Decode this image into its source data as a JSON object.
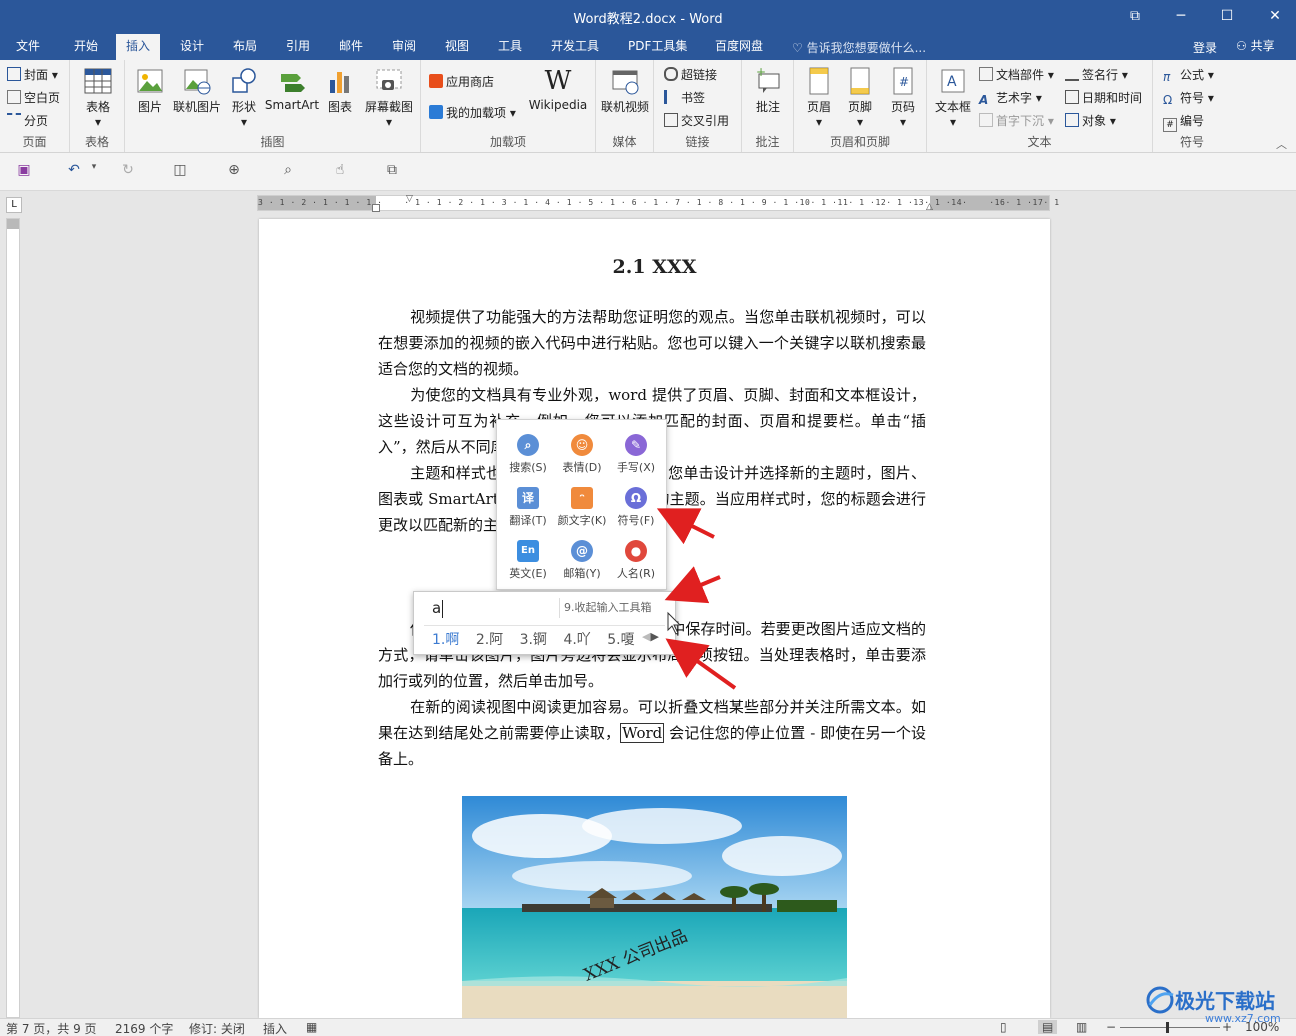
{
  "window": {
    "title": "Word教程2.docx - Word",
    "controls": [
      "⧉",
      "─",
      "☐",
      "✕"
    ]
  },
  "tabs": [
    "文件",
    "开始",
    "插入",
    "设计",
    "布局",
    "引用",
    "邮件",
    "审阅",
    "视图",
    "工具",
    "开发工具",
    "PDF工具集",
    "百度网盘"
  ],
  "active_tab": "插入",
  "tell_me": "告诉我您想要做什么...",
  "login": "登录",
  "share": "共享",
  "ribbon": {
    "pages": {
      "label": "页面",
      "items": [
        "封面",
        "空白页",
        "分页"
      ]
    },
    "tables": {
      "label": "表格",
      "items": [
        "表格"
      ]
    },
    "illustrations": {
      "label": "插图",
      "items": [
        "图片",
        "联机图片",
        "形状",
        "SmartArt",
        "图表",
        "屏幕截图"
      ]
    },
    "addins": {
      "label": "加载项",
      "items": [
        "应用商店",
        "我的加载项",
        "Wikipedia"
      ]
    },
    "media": {
      "label": "媒体",
      "items": [
        "联机视频"
      ]
    },
    "links": {
      "label": "链接",
      "items": [
        "超链接",
        "书签",
        "交叉引用"
      ]
    },
    "comments": {
      "label": "批注",
      "items": [
        "批注"
      ]
    },
    "header_footer": {
      "label": "页眉和页脚",
      "items": [
        "页眉",
        "页脚",
        "页码"
      ]
    },
    "text": {
      "label": "文本",
      "items": [
        "文本框",
        "文档部件",
        "艺术字",
        "首字下沉",
        "签名行",
        "日期和时间",
        "对象"
      ]
    },
    "symbols": {
      "label": "符号",
      "items": [
        "公式",
        "符号",
        "编号"
      ]
    }
  },
  "ruler_ticks": "3 · 1 · 2 · 1 · 1 · 1 ·    · 1 · 1 · 2 · 1 · 3 · 1 · 4 · 1 · 5 · 1 · 6 · 1 · 7 · 1 · 8 · 1 · 9 · 1 ·10· 1 ·11· 1 ·12· 1 ·13· 1 ·14·    ·16· 1 ·17· 1",
  "document": {
    "heading": "2.1 XXX",
    "p1": "视频提供了功能强大的方法帮助您证明您的观点。当您单击联机视频时，可以在想要添加的视频的嵌入代码中进行粘贴。您也可以键入一个关键字以联机搜索最适合您的文档的视频。",
    "p2": "为使您的文档具有专业外观，word 提供了页眉、页脚、封面和文本框设计，这些设计可互为补充。例如，您可以添加匹配的封面、页眉和提要栏。单击“插入”，然后从不同库中选择所需元素。",
    "p3": "主题和样式也有助于文档保持协调。当您单击设计并选择新的主题时，图片、图表或 SmartArt 图形将会更改以匹配新的主题。当应用样式时，您的标题会进行更改以匹配新的主题。",
    "p4": "使用在需要位置出现的新按钮在 Word 中保存时间。若要更改图片适应文档的方式，请单击该图片，图片旁边将会显示布局选项按钮。当处理表格时，单击要添加行或列的位置，然后单击加号。",
    "p5_a": "在新的阅读视图中阅读更加容易。可以折叠文档某些部分并关注所需文本。如果在达到结尾处之前需要停止读取，",
    "p5_word": "Word",
    "p5_b": " 会记住您的停止位置 - 即使在另一个设备上。",
    "image_caption": "XXX 公司出品"
  },
  "ime_toolbox": {
    "items": [
      {
        "label": "搜索(S)",
        "icon": "search-icon",
        "color": "#5b8fd6"
      },
      {
        "label": "表情(D)",
        "icon": "emoji-icon",
        "color": "#f08a3c"
      },
      {
        "label": "手写(X)",
        "icon": "handwrite-icon",
        "color": "#8a67d6"
      },
      {
        "label": "翻译(T)",
        "icon": "translate-icon",
        "color": "#5b8fd6"
      },
      {
        "label": "颜文字(K)",
        "icon": "kaomoji-icon",
        "color": "#f08a3c"
      },
      {
        "label": "符号(F)",
        "icon": "omega-icon",
        "color": "#6a6fd8"
      },
      {
        "label": "英文(E)",
        "icon": "english-icon",
        "color": "#3c8ee0"
      },
      {
        "label": "邮箱(Y)",
        "icon": "email-icon",
        "color": "#5b8fd6"
      },
      {
        "label": "人名(R)",
        "icon": "person-icon",
        "color": "#e0483c"
      }
    ]
  },
  "ime_candidates": {
    "composition": "a",
    "collapse_hint": "9.收起输入工具箱",
    "candidates": [
      "1.啊",
      "2.阿",
      "3.锕",
      "4.吖",
      "5.嗄"
    ]
  },
  "status": {
    "page": "第 7 页，共 9 页",
    "words": "2169 个字",
    "track": "修订: 关闭",
    "mode": "插入",
    "zoom": "100%"
  },
  "brand": {
    "name": "极光下载站",
    "url": "www.xz7.com"
  },
  "colors": {
    "word_blue": "#2b579a",
    "arrow_red": "#e02020"
  }
}
